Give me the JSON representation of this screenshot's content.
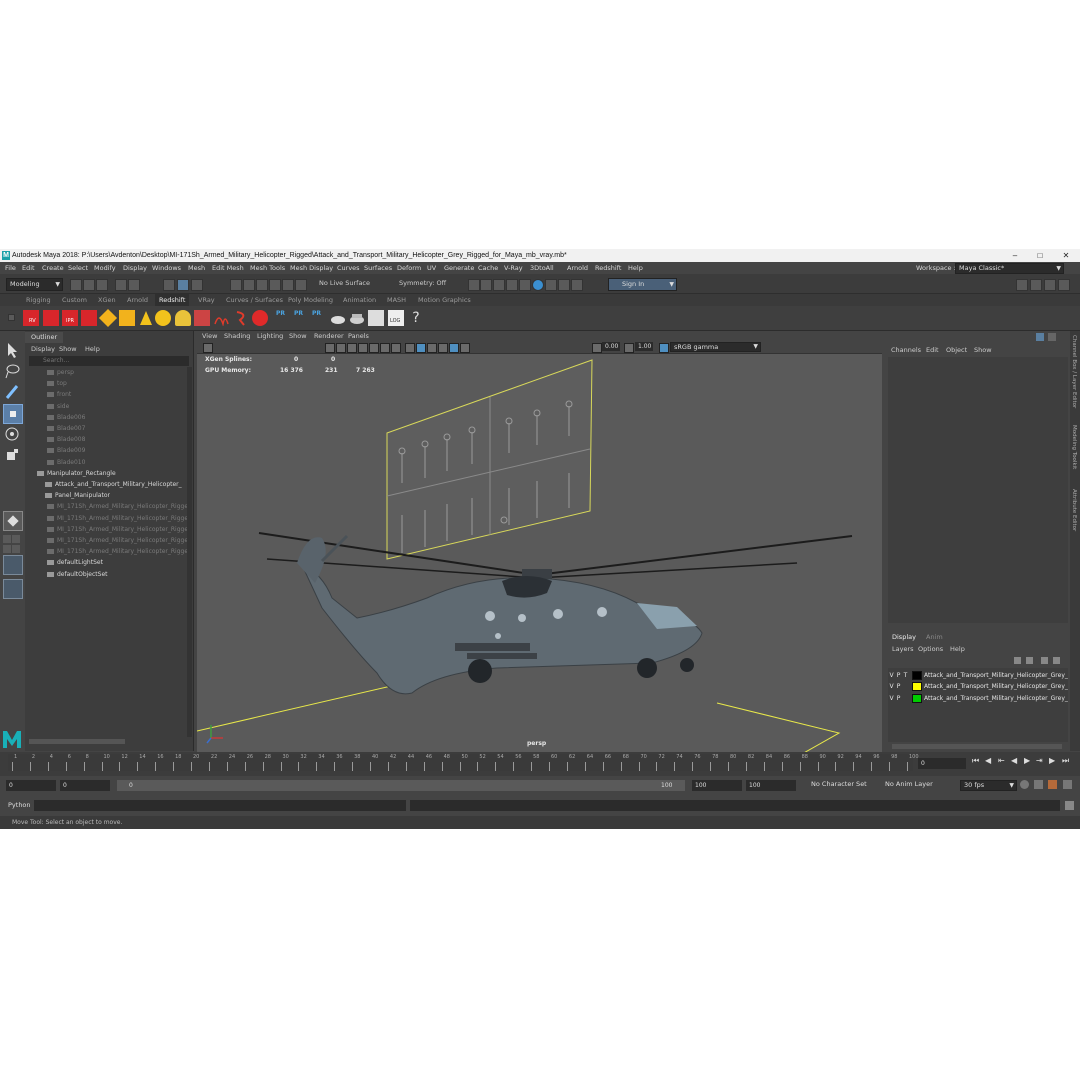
{
  "window": {
    "title": "Autodesk Maya 2018: P:\\Users\\Avdenton\\Desktop\\MI-171Sh_Armed_Military_Helicopter_Rigged\\Attack_and_Transport_Military_Helicopter_Grey_Rigged_for_Maya_mb_vray.mb*",
    "logo": "M"
  },
  "menubar": [
    "File",
    "Edit",
    "Create",
    "Select",
    "Modify",
    "Display",
    "Windows",
    "Mesh",
    "Edit Mesh",
    "Mesh Tools",
    "Mesh Display",
    "Curves",
    "Surfaces",
    "Deform",
    "UV",
    "Generate",
    "Cache",
    "V-Ray",
    "3DtoAll",
    "Arnold",
    "Redshift",
    "Help"
  ],
  "workspace": {
    "label": "Workspace :",
    "value": "Maya Classic*"
  },
  "statusline": {
    "mode": "Modeling",
    "live_surface": "No Live Surface",
    "symmetry": "Symmetry: Off",
    "sign_in": "Sign In"
  },
  "shelf_tabs": [
    "Rigging",
    "Custom",
    "XGen",
    "Arnold",
    "Redshift",
    "VRay",
    "Curves / Surfaces",
    "Poly Modeling",
    "Animation",
    "MASH",
    "Motion Graphics"
  ],
  "active_shelf_tab": "Redshift",
  "shelf_icon_labels": {
    "rv": "RV",
    "ipr": "IPR",
    "pr1": "PR",
    "pr2": "PR",
    "pr3": "PR",
    "log": "LOG",
    "help": "?"
  },
  "outliner": {
    "tab": "Outliner",
    "menu": [
      "Display",
      "Show",
      "Help"
    ],
    "search_placeholder": "Search...",
    "items": [
      {
        "label": "persp",
        "dim": true
      },
      {
        "label": "top",
        "dim": true
      },
      {
        "label": "front",
        "dim": true
      },
      {
        "label": "side",
        "dim": true
      },
      {
        "label": "Blade006",
        "dim": true
      },
      {
        "label": "Blade007",
        "dim": true
      },
      {
        "label": "Blade008",
        "dim": true
      },
      {
        "label": "Blade009",
        "dim": true
      },
      {
        "label": "Blade010",
        "dim": true
      },
      {
        "label": "Manipulator_Rectangle",
        "dim": false
      },
      {
        "label": "Attack_and_Transport_Military_Helicopter_",
        "dim": false
      },
      {
        "label": "Panel_Manipulator",
        "dim": false
      },
      {
        "label": "MI_171Sh_Armed_Military_Helicopter_Rigged",
        "dim": true
      },
      {
        "label": "MI_171Sh_Armed_Military_Helicopter_Rigged",
        "dim": true
      },
      {
        "label": "MI_171Sh_Armed_Military_Helicopter_Rigged",
        "dim": true
      },
      {
        "label": "MI_171Sh_Armed_Military_Helicopter_Rigged",
        "dim": true
      },
      {
        "label": "MI_171Sh_Armed_Military_Helicopter_Rigged",
        "dim": true
      },
      {
        "label": "defaultLightSet",
        "dim": false
      },
      {
        "label": "defaultObjectSet",
        "dim": false
      }
    ]
  },
  "viewport": {
    "menu": [
      "View",
      "Shading",
      "Lighting",
      "Show",
      "Renderer",
      "Panels"
    ],
    "exposure": "0.00",
    "gamma": "1.00",
    "color_space": "sRGB gamma",
    "camera_label": "persp",
    "hud": [
      {
        "label": "XGen Splines:",
        "v1": "0",
        "v2": "0",
        "v3": ""
      },
      {
        "label": "GPU Memory:",
        "v1": "16 376",
        "v2": "231",
        "v3": "7 263"
      }
    ],
    "panel_labels": [
      "Tooling",
      "Wheels",
      "Dampeners",
      "Gears",
      "Front Door",
      "Side Door",
      "Back Door",
      "Front Door L",
      "Door R",
      "Back Door",
      "Sensor",
      "Sensor 2",
      "Sensor 3",
      "Sensor 4"
    ]
  },
  "channel_box": {
    "menu": [
      "Channels",
      "Edit",
      "Object",
      "Show"
    ]
  },
  "layer_editor": {
    "tabs": [
      "Display",
      "Anim"
    ],
    "menu": [
      "Layers",
      "Options",
      "Help"
    ],
    "layers": [
      {
        "v": "V",
        "p": "P",
        "t": "T",
        "color": "#000000",
        "name": "Attack_and_Transport_Military_Helicopter_Grey_Rig"
      },
      {
        "v": "V",
        "p": "P",
        "t": "",
        "color": "#ffff00",
        "name": "Attack_and_Transport_Military_Helicopter_Grey_Rig"
      },
      {
        "v": "V",
        "p": "P",
        "t": "",
        "color": "#00cc00",
        "name": "Attack_and_Transport_Military_Helicopter_Grey_Rig"
      }
    ]
  },
  "side_tabs": [
    "Channel Box / Layer Editor",
    "Modeling Toolkit",
    "Attribute Editor"
  ],
  "timeline": {
    "ticks": [
      "1",
      "2",
      "4",
      "6",
      "8",
      "10",
      "12",
      "14",
      "16",
      "18",
      "20",
      "22",
      "24",
      "26",
      "28",
      "30",
      "32",
      "34",
      "36",
      "38",
      "40",
      "42",
      "44",
      "46",
      "48",
      "50",
      "52",
      "54",
      "56",
      "58",
      "60",
      "62",
      "64",
      "66",
      "68",
      "70",
      "72",
      "74",
      "76",
      "78",
      "80",
      "82",
      "84",
      "86",
      "88",
      "90",
      "92",
      "94",
      "96",
      "98",
      "100"
    ],
    "current_frame": "0"
  },
  "range": {
    "start": "0",
    "start2": "0",
    "slider_start": "0",
    "slider_end": "100",
    "end": "100",
    "end2": "100",
    "character_set": "No Character Set",
    "anim_layer": "No Anim Layer",
    "fps": "30 fps"
  },
  "command": {
    "label": "Python"
  },
  "help": {
    "text": "Move Tool: Select an object to move."
  }
}
